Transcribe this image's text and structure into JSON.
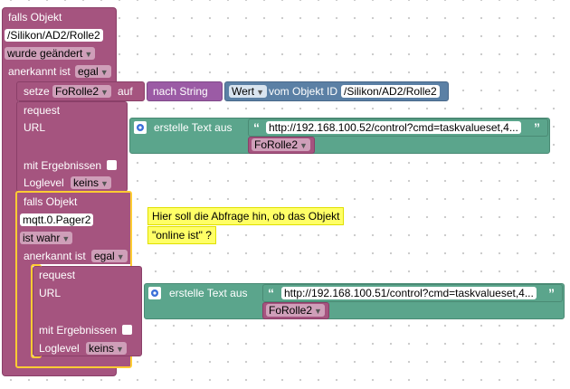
{
  "outer_if": {
    "label": "falls Objekt",
    "object_id": "/Silikon/AD2/Rolle2",
    "changed": "wurde geändert",
    "ack_label": "anerkannt ist",
    "ack_value": "egal"
  },
  "set_block": {
    "label": "setze",
    "var": "FoRolle2",
    "on": "auf",
    "convert": "nach String",
    "value": "Wert",
    "from_label": "vom Objekt ID",
    "object_id": "/Silikon/AD2/Rolle2"
  },
  "request1": {
    "label": "request",
    "url_label": "URL",
    "results_label": "mit Ergebnissen",
    "loglevel_label": "Loglevel",
    "loglevel_value": "keins",
    "text_label": "erstelle Text aus",
    "open_quote": "“",
    "close_quote": "”",
    "url": "http://192.168.100.52/control?cmd=taskvalueset,4...",
    "var": "FoRolle2"
  },
  "inner_if": {
    "label": "falls Objekt",
    "object_id": "mqtt.0.Pager2",
    "condition": "ist wahr",
    "ack_label": "anerkannt ist",
    "ack_value": "egal"
  },
  "comment": {
    "line1": "Hier soll die Abfrage hin, ob das Objekt",
    "line2": "\"online ist\" ?"
  },
  "request2": {
    "label": "request",
    "url_label": "URL",
    "results_label": "mit Ergebnissen",
    "loglevel_label": "Loglevel",
    "loglevel_value": "keins",
    "text_label": "erstelle Text aus",
    "open_quote": "“",
    "close_quote": "”",
    "url": "http://192.168.100.51/control?cmd=taskvalueset,4...",
    "var": "FoRolle2"
  },
  "colors": {
    "trigger": "#a5547f",
    "text": "#5ba58c",
    "convert": "#9b5ba5",
    "object": "#5b80a5",
    "comment": "#ffff66",
    "selection": "#ffcc33"
  }
}
